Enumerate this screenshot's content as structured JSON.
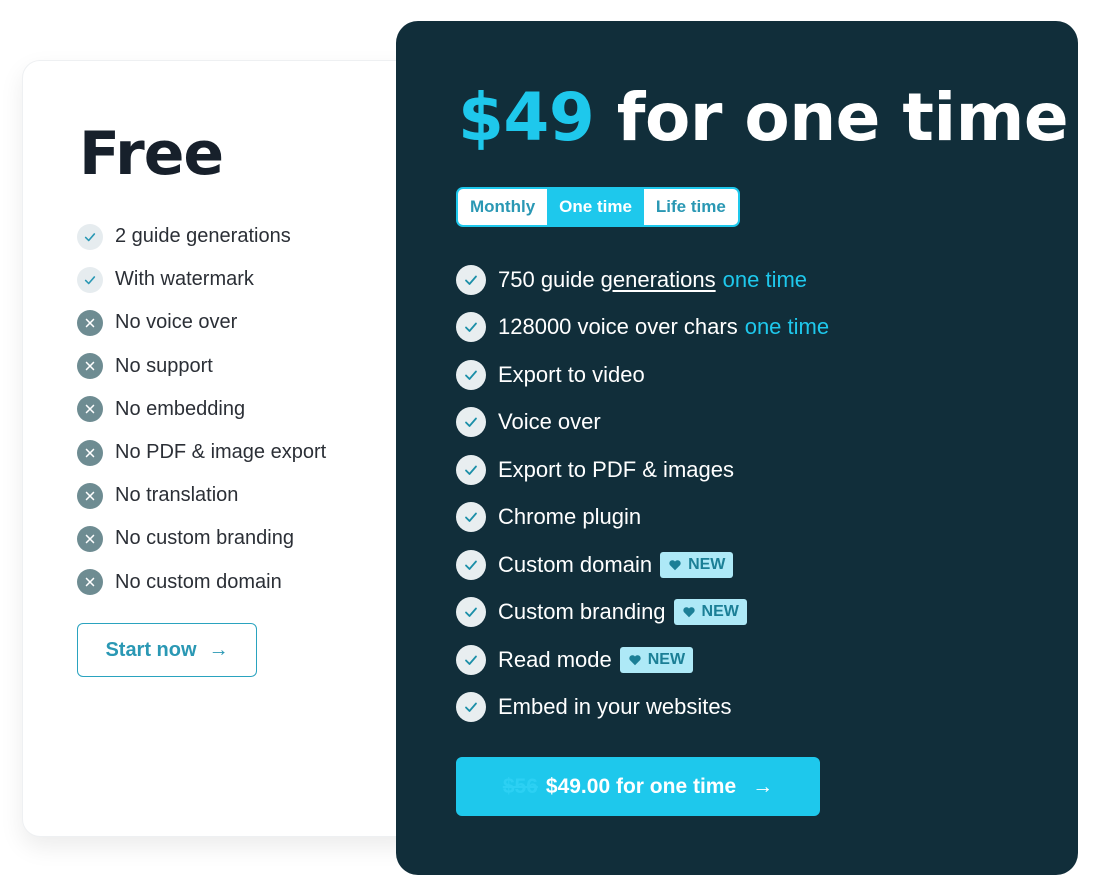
{
  "free_plan": {
    "title": "Free",
    "features": [
      {
        "type": "check",
        "icon": "check-icon",
        "text": "2 guide generations"
      },
      {
        "type": "check",
        "icon": "check-icon",
        "text": "With watermark"
      },
      {
        "type": "x",
        "icon": "x-icon",
        "text": "No voice over"
      },
      {
        "type": "x",
        "icon": "x-icon",
        "text": "No support"
      },
      {
        "type": "x",
        "icon": "x-icon",
        "text": "No embedding"
      },
      {
        "type": "x",
        "icon": "x-icon",
        "text": "No PDF & image export"
      },
      {
        "type": "x",
        "icon": "x-icon",
        "text": "No translation"
      },
      {
        "type": "x",
        "icon": "x-icon",
        "text": "No custom branding"
      },
      {
        "type": "x",
        "icon": "x-icon",
        "text": "No custom domain"
      }
    ],
    "cta_label": "Start now",
    "cta_icon": "arrow-right-icon"
  },
  "pro_plan": {
    "price": "$49",
    "title_suffix": "for one time",
    "billing_toggle": {
      "options": [
        "Monthly",
        "One time",
        "Life time"
      ],
      "selected": "One time"
    },
    "features": [
      {
        "text": "750 guide",
        "underlined": "generations",
        "highlight": "one time"
      },
      {
        "text": "128000 voice over chars",
        "highlight": "one time"
      },
      {
        "text": "Export to video"
      },
      {
        "text": "Voice over"
      },
      {
        "text": "Export to PDF & images"
      },
      {
        "text": "Chrome plugin"
      },
      {
        "text": "Custom domain",
        "badge": "NEW"
      },
      {
        "text": "Custom branding",
        "badge": "NEW"
      },
      {
        "text": "Read mode",
        "badge": "NEW"
      },
      {
        "text": "Embed in your websites"
      }
    ],
    "badge_icon": "heart-icon",
    "cta": {
      "old_price": "$56",
      "label": "$49.00 for one time",
      "icon": "arrow-right-icon"
    }
  },
  "colors": {
    "accent": "#1ec8ec",
    "dark_card": "#112e3a",
    "badge_bg": "#aee9f7",
    "x_icon": "#6e8c92"
  }
}
